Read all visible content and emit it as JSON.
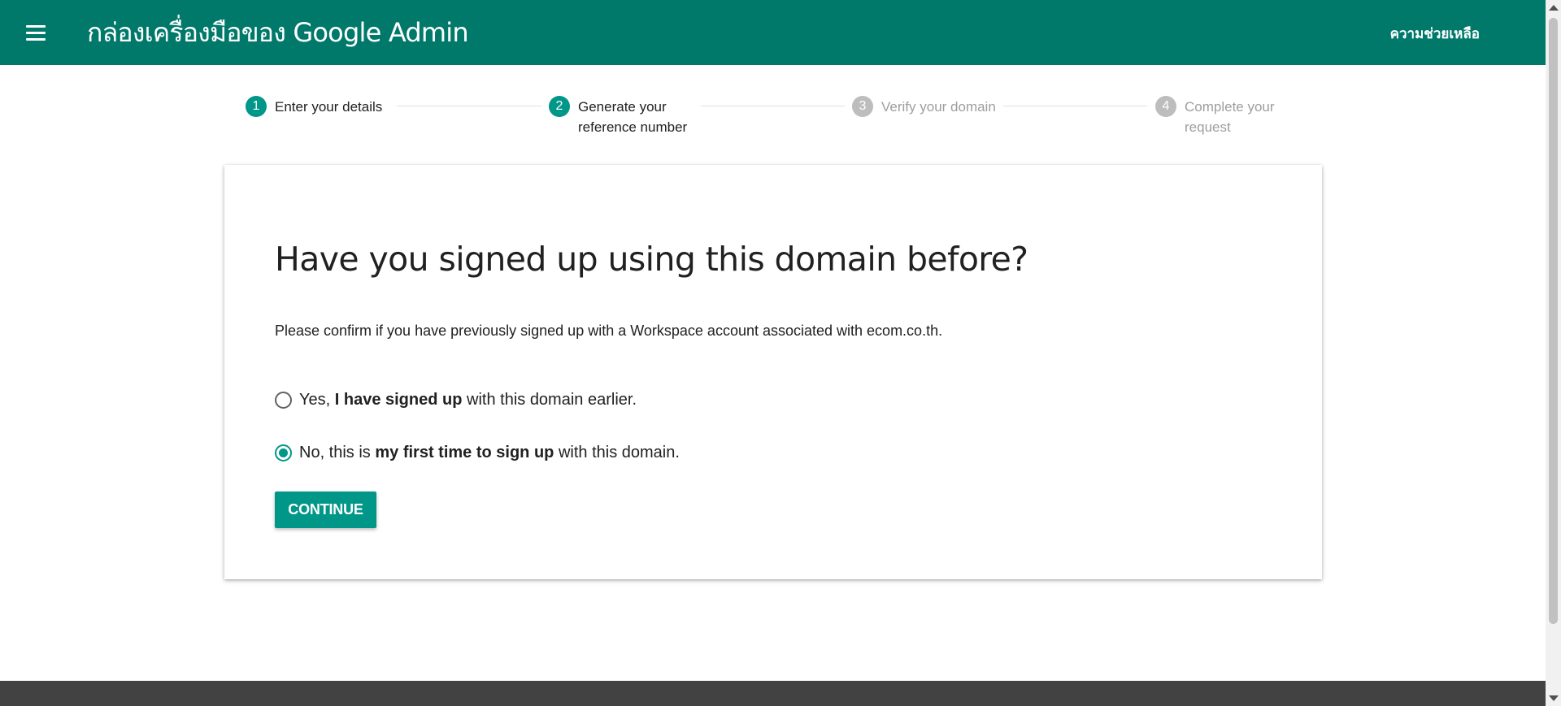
{
  "header": {
    "title": "กล่องเครื่องมือของ Google Admin",
    "help_label": "ความช่วยเหลือ",
    "menu_icon": "menu-icon",
    "background_color": "#00796b"
  },
  "stepper": {
    "steps": [
      {
        "number": "1",
        "label": "Enter your details",
        "state": "active"
      },
      {
        "number": "2",
        "label": "Generate your reference number",
        "state": "active"
      },
      {
        "number": "3",
        "label": "Verify your domain",
        "state": "inactive"
      },
      {
        "number": "4",
        "label": "Complete your request",
        "state": "inactive"
      }
    ],
    "active_color": "#009688",
    "inactive_color": "#bdbdbd"
  },
  "card": {
    "title": "Have you signed up using this domain before?",
    "description": "Please confirm if you have previously signed up with a Workspace account associated with ecom.co.th.",
    "options": [
      {
        "prefix": "Yes, ",
        "bold": "I have signed up",
        "suffix": " with this domain earlier.",
        "selected": false
      },
      {
        "prefix": "No, this is ",
        "bold": "my first time to sign up",
        "suffix": " with this domain.",
        "selected": true
      }
    ],
    "continue_label": "CONTINUE",
    "accent_color": "#009688"
  }
}
